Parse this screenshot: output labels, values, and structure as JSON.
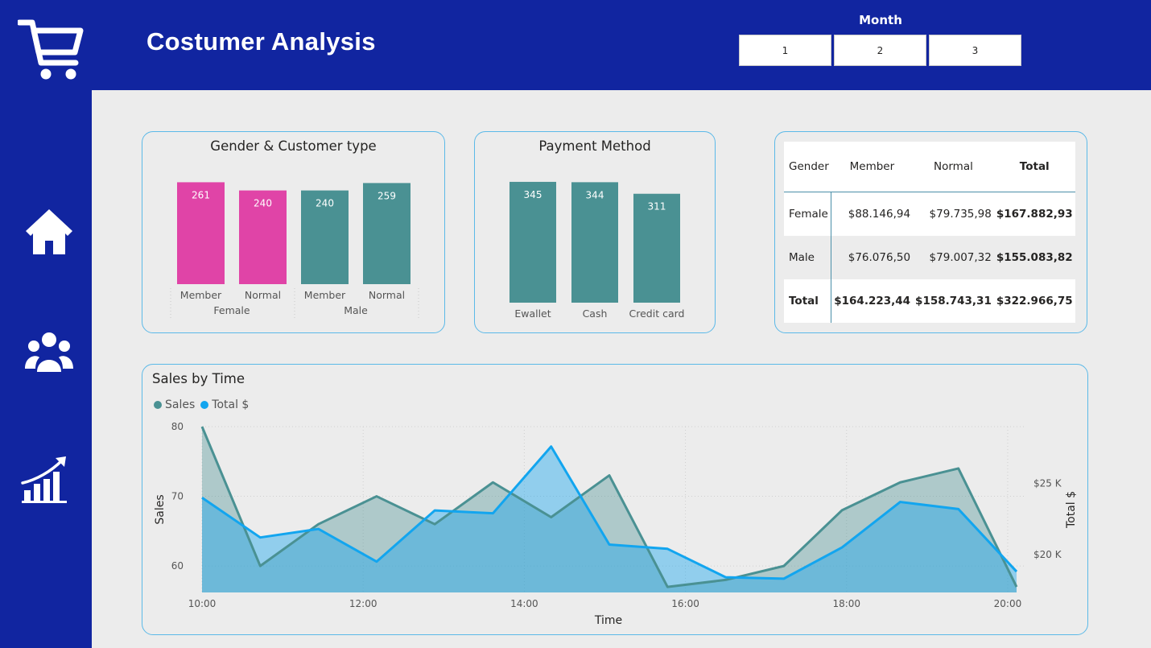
{
  "header": {
    "title": "Costumer Analysis"
  },
  "slicer": {
    "label": "Month",
    "options": [
      "1",
      "2",
      "3"
    ]
  },
  "nav": {
    "icons": [
      "cart-icon",
      "home-icon",
      "users-icon",
      "growth-chart-icon"
    ]
  },
  "colors": {
    "navy": "#1125a0",
    "pink": "#e044a7",
    "teal": "#4a9193",
    "blue": "#12a5ef",
    "card_border": "#5bb9e8"
  },
  "chart_data": [
    {
      "type": "bar",
      "title": "Gender & Customer type",
      "categories": [
        "Member",
        "Normal",
        "Member",
        "Normal"
      ],
      "groups": [
        "Female",
        "Female",
        "Male",
        "Male"
      ],
      "group_labels": [
        "Female",
        "Male"
      ],
      "values": [
        261,
        240,
        240,
        259
      ],
      "colors": [
        "#e044a7",
        "#e044a7",
        "#4a9193",
        "#4a9193"
      ],
      "data_labels": [
        "261",
        "240",
        "240",
        "259"
      ]
    },
    {
      "type": "bar",
      "title": "Payment Method",
      "categories": [
        "Ewallet",
        "Cash",
        "Credit card"
      ],
      "values": [
        345,
        344,
        311
      ],
      "data_labels": [
        "345",
        "344",
        "311"
      ]
    },
    {
      "type": "table",
      "columns": [
        "Gender",
        "Member",
        "Normal",
        "Total"
      ],
      "rows": [
        [
          "Female",
          "$88.146,94",
          "$79.735,98",
          "$167.882,93"
        ],
        [
          "Male",
          "$76.076,50",
          "$79.007,32",
          "$155.083,82"
        ],
        [
          "Total",
          "$164.223,44",
          "$158.743,31",
          "$322.966,75"
        ]
      ]
    },
    {
      "type": "area",
      "title": "Sales by Time",
      "xlabel": "Time",
      "ylabel": "Sales",
      "y2label": "Total $",
      "x": [
        "10:00",
        "10:43",
        "11:26",
        "12:10",
        "12:53",
        "13:36",
        "14:20",
        "15:03",
        "15:46",
        "16:30",
        "17:13",
        "17:56",
        "18:40",
        "19:23",
        "20:06"
      ],
      "x_ticks": [
        "10:00",
        "12:00",
        "14:00",
        "16:00",
        "18:00",
        "20:00"
      ],
      "y_ticks": [
        "80",
        "70",
        "60"
      ],
      "y2_ticks": [
        "$25 K",
        "$20 K"
      ],
      "ylim": [
        56.2,
        80
      ],
      "y2lim": [
        17330,
        29000
      ],
      "legend": [
        "Sales",
        "Total $"
      ],
      "series": [
        {
          "name": "Sales",
          "axis": "left",
          "values": [
            80,
            60,
            66,
            70,
            66,
            72,
            67,
            73,
            57,
            58,
            60,
            68,
            72,
            74,
            57
          ]
        },
        {
          "name": "Total $",
          "axis": "right",
          "values": [
            24000,
            21200,
            21800,
            19500,
            23100,
            22900,
            27600,
            20700,
            20400,
            18400,
            18300,
            20500,
            23700,
            23200,
            18800
          ]
        }
      ]
    }
  ]
}
